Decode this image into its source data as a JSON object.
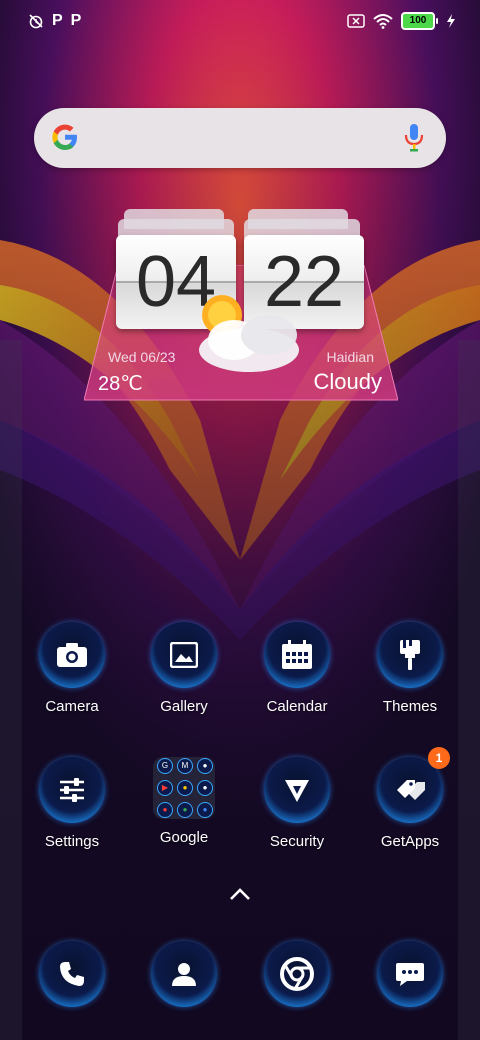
{
  "status_bar": {
    "left_icons": [
      "alarm-off-icon",
      "p-notification-icon",
      "p-notification-icon"
    ],
    "p_glyph": "P",
    "battery": "100"
  },
  "search": {
    "placeholder": ""
  },
  "clock_widget": {
    "hour": "04",
    "minute": "22",
    "date": "Wed  06/23",
    "temperature": "28℃",
    "city": "Haidian",
    "condition": "Cloudy"
  },
  "apps": [
    {
      "label": "Camera",
      "icon": "camera-icon"
    },
    {
      "label": "Gallery",
      "icon": "gallery-icon"
    },
    {
      "label": "Calendar",
      "icon": "calendar-icon"
    },
    {
      "label": "Themes",
      "icon": "themes-icon"
    },
    {
      "label": "Settings",
      "icon": "settings-icon"
    },
    {
      "label": "Google",
      "icon": "google-folder-icon"
    },
    {
      "label": "Security",
      "icon": "security-icon"
    },
    {
      "label": "GetApps",
      "icon": "getapps-icon",
      "badge": "1"
    }
  ],
  "folder_letters": [
    "G",
    "M",
    "●",
    "▶",
    "●",
    "●",
    "●",
    "●",
    "●"
  ],
  "dock": [
    {
      "icon": "phone-icon"
    },
    {
      "icon": "contacts-icon"
    },
    {
      "icon": "chrome-icon"
    },
    {
      "icon": "messages-icon"
    }
  ],
  "colors": {
    "accent_blue": "#1d8ef0",
    "badge": "#ff6a1a",
    "battery": "#4dd84a"
  }
}
